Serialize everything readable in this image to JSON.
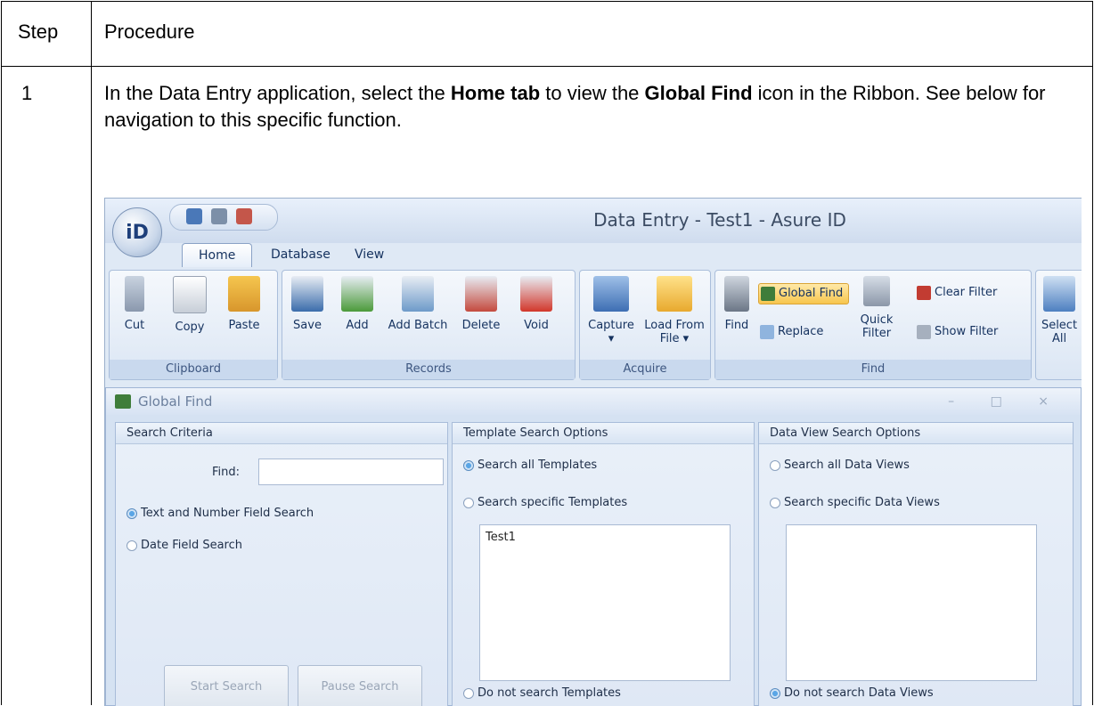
{
  "table": {
    "col_step": "Step",
    "col_procedure": "Procedure",
    "row_step": "1",
    "procedure_parts": {
      "p1": "In the Data Entry application, select the ",
      "b1": "Home tab",
      "p2": " to view the ",
      "b2": "Global Find",
      "p3": " icon in the Ribbon. See below for navigation to this specific function."
    }
  },
  "app": {
    "title": "Data Entry - Test1 - Asure ID",
    "orb_label": "iD",
    "tabs": [
      "Home",
      "Database",
      "View"
    ],
    "groups": {
      "clipboard": {
        "label": "Clipboard",
        "buttons": [
          "Cut",
          "Copy",
          "Paste"
        ]
      },
      "records": {
        "label": "Records",
        "buttons": [
          "Save",
          "Add",
          "Add Batch",
          "Delete",
          "Void"
        ]
      },
      "acquire": {
        "label": "Acquire",
        "capture": "Capture",
        "capture_arrow": "▾",
        "load_from": "Load From",
        "load_file": "File ▾"
      },
      "find": {
        "label": "Find",
        "find": "Find",
        "global_find": "Global Find",
        "replace": "Replace",
        "quick": "Quick",
        "filter": "Filter",
        "clear_filter": "Clear Filter",
        "show_filter": "Show Filter"
      },
      "select": {
        "line1": "Select",
        "line2": "All"
      }
    }
  },
  "global_find": {
    "title": "Global Find",
    "window_controls": "– □ ×",
    "search_criteria": {
      "header": "Search Criteria",
      "find_label": "Find:",
      "find_value": "",
      "option_text": "Text and Number Field Search",
      "option_date": "Date Field Search",
      "start_button": "Start Search",
      "pause_button": "Pause Search"
    },
    "template_options": {
      "header": "Template Search Options",
      "all": "Search all Templates",
      "specific": "Search specific Templates",
      "list_item": "Test1",
      "none": "Do not search Templates"
    },
    "dataview_options": {
      "header": "Data View Search Options",
      "all": "Search all Data Views",
      "specific": "Search specific Data Views",
      "none": "Do not search Data Views"
    }
  },
  "colors": {
    "ribbon_bg": "#dfe9f5",
    "accent": "#5aa6e6"
  }
}
